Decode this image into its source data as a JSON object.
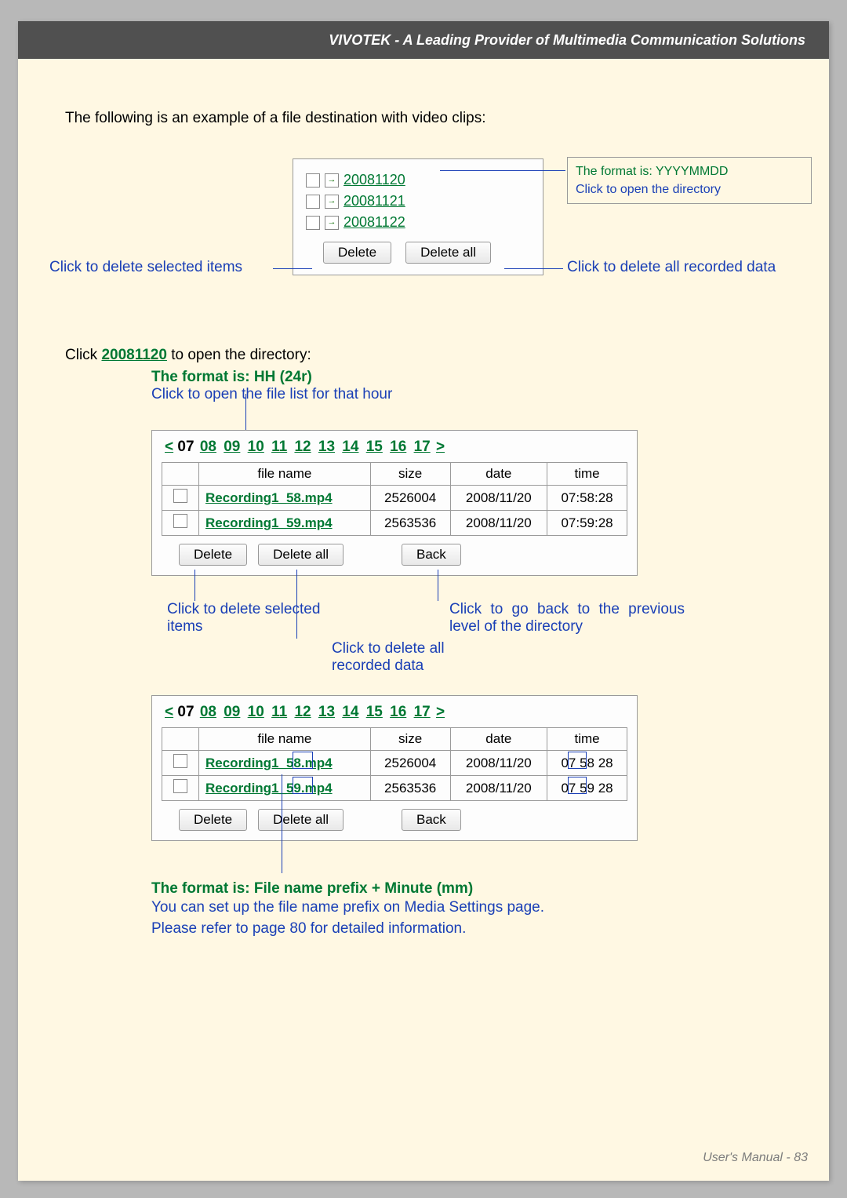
{
  "header": {
    "title": "VIVOTEK - A Leading Provider of Multimedia Communication Solutions"
  },
  "footer": {
    "manual": "User's Manual - ",
    "page": "83"
  },
  "intro": "The following is an example of a file destination with video clips:",
  "dirBox": {
    "items": [
      "20081120",
      "20081121",
      "20081122"
    ],
    "delete": "Delete",
    "deleteAll": "Delete all"
  },
  "annotations": {
    "formatYYYYMMDD": "The format is: YYYYMMDD",
    "clickOpenDir": "Click to open the directory",
    "deleteSelected": "Click to delete selected items",
    "deleteAll": "Click to delete all recorded data",
    "formatHH": "The format is: HH (24r)",
    "clickFileList": "Click to open the file list for that hour",
    "deleteSelectedMulti": "Click to delete selected items",
    "deleteAllMulti": "Click to delete all recorded data",
    "goBack": "Click to go back to the previous level of the directory"
  },
  "clickOpen": {
    "prefix": "Click ",
    "link": "20081120",
    "suffix": " to open the directory:"
  },
  "fileBox": {
    "nav": {
      "prev": "<",
      "next": ">",
      "hours": [
        "07",
        "08",
        "09",
        "10",
        "11",
        "12",
        "13",
        "14",
        "15",
        "16",
        "17"
      ]
    },
    "headers": [
      "file name",
      "size",
      "date",
      "time"
    ],
    "rows": [
      {
        "name": "Recording1_58.mp4",
        "size": "2526004",
        "date": "2008/11/20",
        "time": "07:58:28"
      },
      {
        "name": "Recording1_59.mp4",
        "size": "2563536",
        "date": "2008/11/20",
        "time": "07:59:28"
      }
    ],
    "delete": "Delete",
    "deleteAll": "Delete all",
    "back": "Back"
  },
  "fileBox2": {
    "rows": [
      {
        "name": "Recording1_58.mp4",
        "size": "2526004",
        "date": "2008/11/20",
        "time": "07 58 28"
      },
      {
        "name": "Recording1_59.mp4",
        "size": "2563536",
        "date": "2008/11/20",
        "time": "07 59 28"
      }
    ]
  },
  "bottom": {
    "formatPrefix": "The format is: File name prefix + Minute (mm)",
    "line1": "You can set up the file name prefix on Media Settings page.",
    "line2": "Please refer to page 80 for detailed information."
  }
}
